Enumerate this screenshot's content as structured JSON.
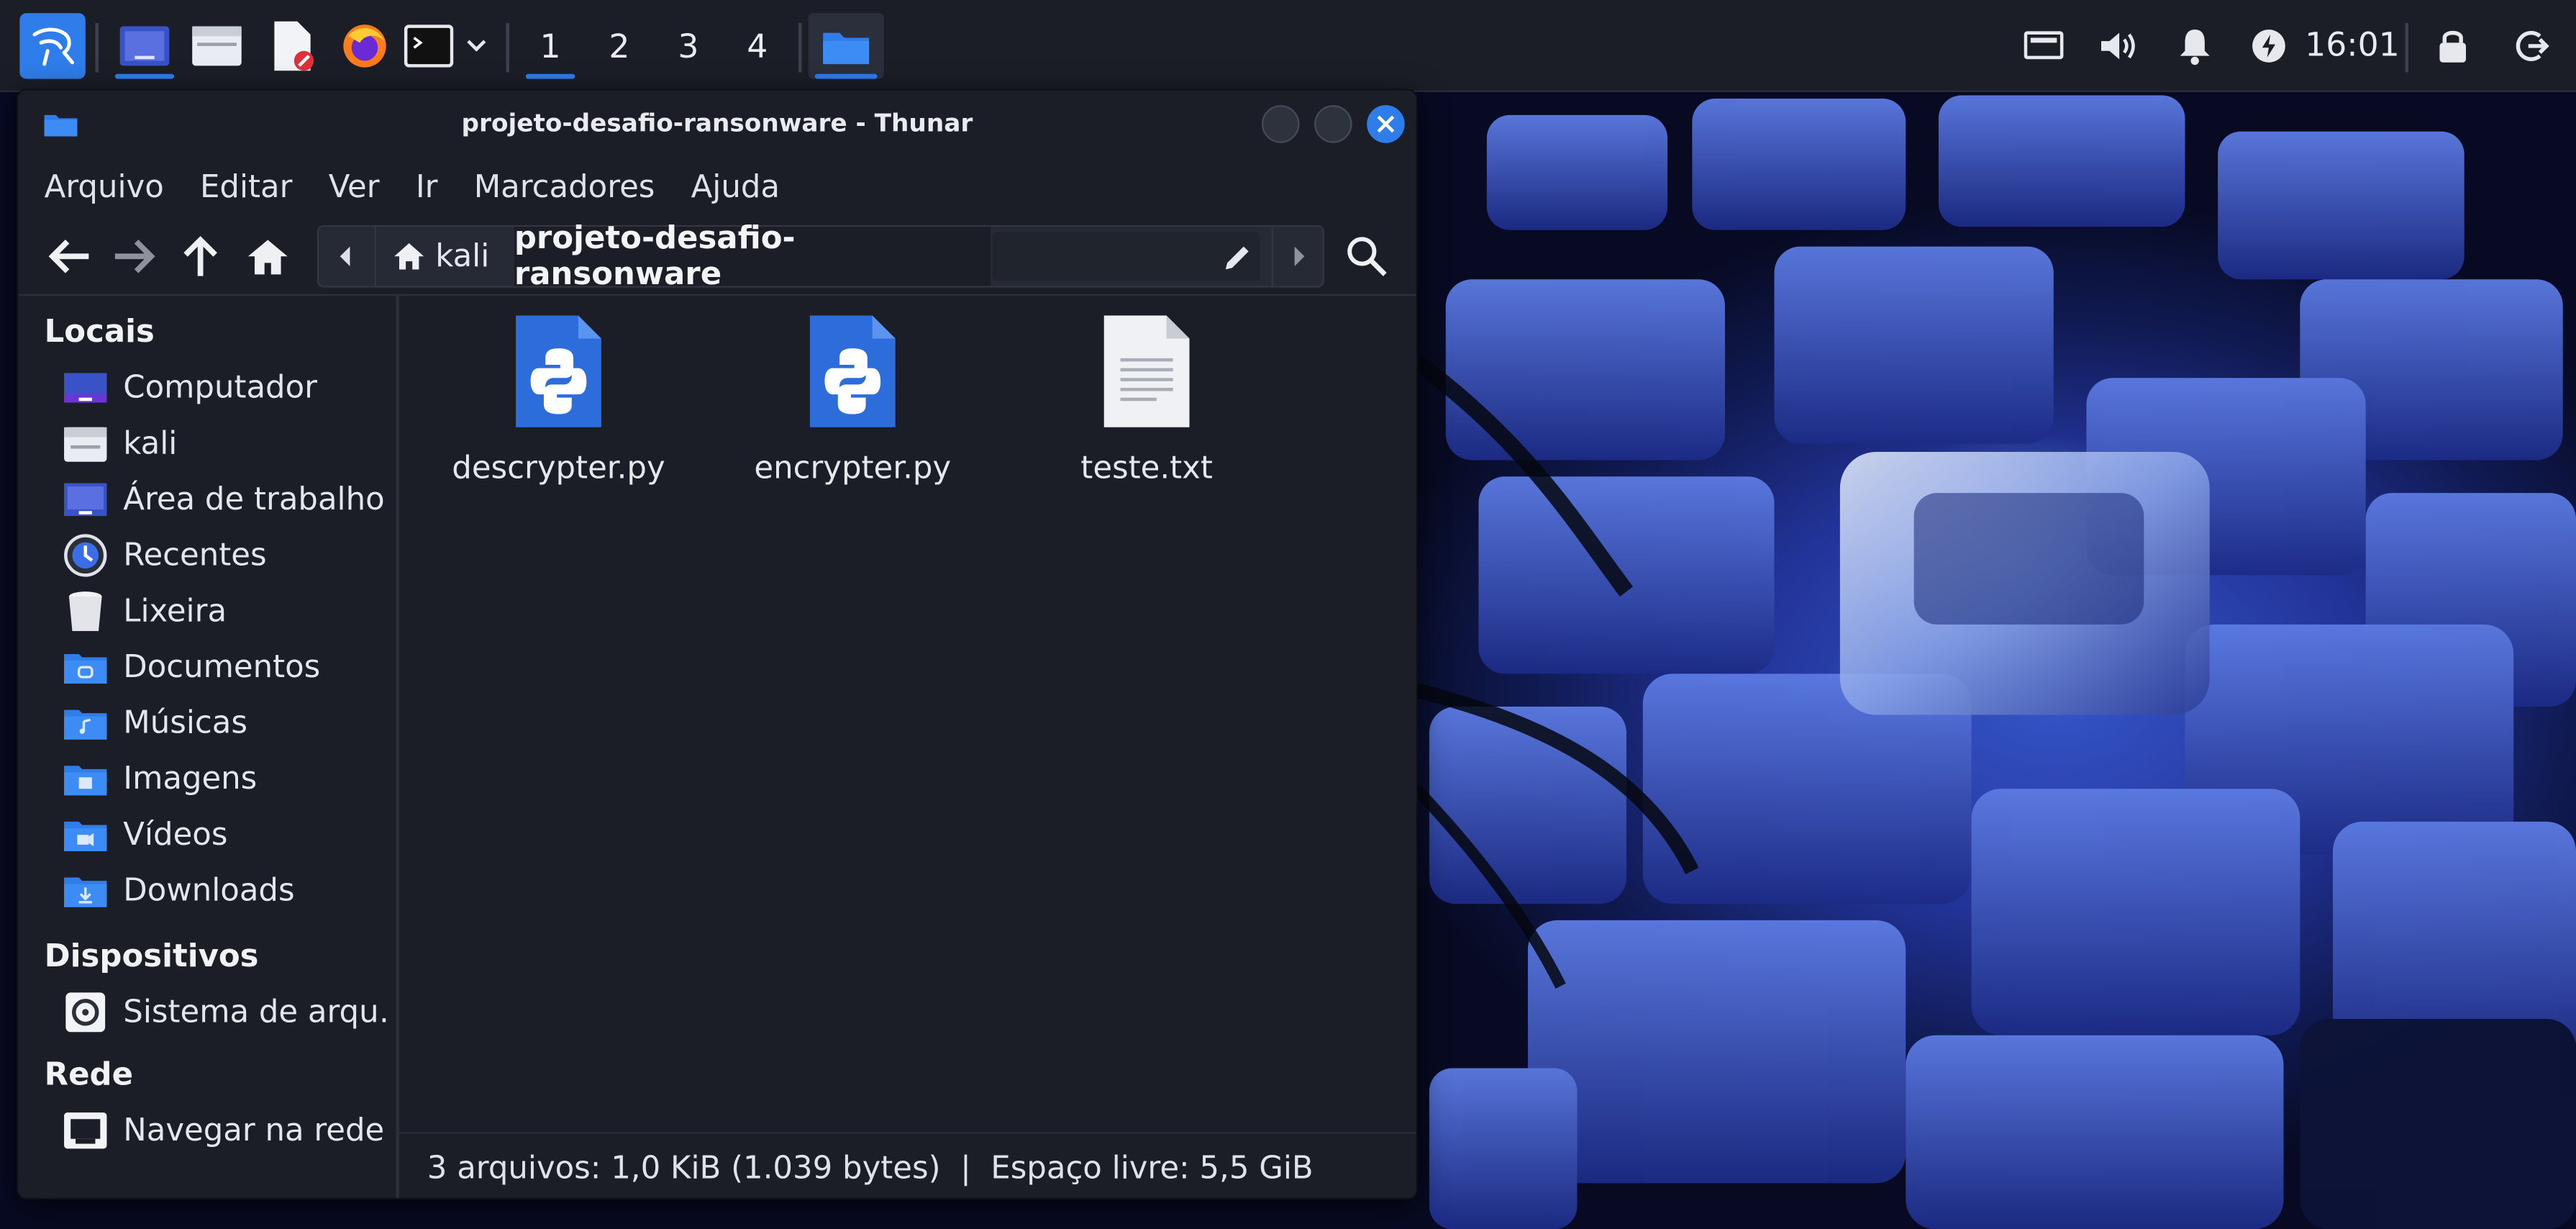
{
  "panel": {
    "workspaces": [
      "1",
      "2",
      "3",
      "4"
    ],
    "active_workspace": "1",
    "clock": "16:01",
    "launchers": [
      "kali-menu-icon",
      "show-desktop-icon",
      "file-manager-icon",
      "text-editor-icon",
      "firefox-icon",
      "terminal-icon"
    ],
    "tray": [
      "display-icon",
      "volume-icon",
      "notification-bell-icon",
      "power-manager-icon",
      "lock-icon",
      "logout-icon"
    ]
  },
  "window": {
    "title": "projeto-desafio-ransonware - Thunar",
    "menu": [
      "Arquivo",
      "Editar",
      "Ver",
      "Ir",
      "Marcadores",
      "Ajuda"
    ],
    "path": {
      "home": "kali",
      "current": "projeto-desafio-ransonware"
    },
    "sidebar": {
      "sections": [
        {
          "title": "Locais",
          "items": [
            {
              "label": "Computador",
              "icon": "computer-icon"
            },
            {
              "label": "kali",
              "icon": "home-folder-icon"
            },
            {
              "label": "Área de trabalho",
              "icon": "desktop-icon"
            },
            {
              "label": "Recentes",
              "icon": "recent-icon"
            },
            {
              "label": "Lixeira",
              "icon": "trash-icon"
            },
            {
              "label": "Documentos",
              "icon": "documents-folder-icon"
            },
            {
              "label": "Músicas",
              "icon": "music-folder-icon"
            },
            {
              "label": "Imagens",
              "icon": "pictures-folder-icon"
            },
            {
              "label": "Vídeos",
              "icon": "videos-folder-icon"
            },
            {
              "label": "Downloads",
              "icon": "downloads-folder-icon"
            }
          ]
        },
        {
          "title": "Dispositivos",
          "items": [
            {
              "label": "Sistema de arqu…",
              "icon": "drive-icon"
            }
          ]
        },
        {
          "title": "Rede",
          "items": [
            {
              "label": "Navegar na rede",
              "icon": "network-icon"
            }
          ]
        }
      ]
    },
    "files": [
      {
        "name": "descrypter.py",
        "icon": "python-file-icon"
      },
      {
        "name": "encrypter.py",
        "icon": "python-file-icon"
      },
      {
        "name": "teste.txt",
        "icon": "text-file-icon"
      }
    ],
    "status": "3 arquivos: 1,0 KiB (1.039 bytes)  |  Espaço livre: 5,5 GiB"
  },
  "colors": {
    "accent": "#2f7dea",
    "panel": "#1b1e27",
    "window": "#1b1e26"
  }
}
